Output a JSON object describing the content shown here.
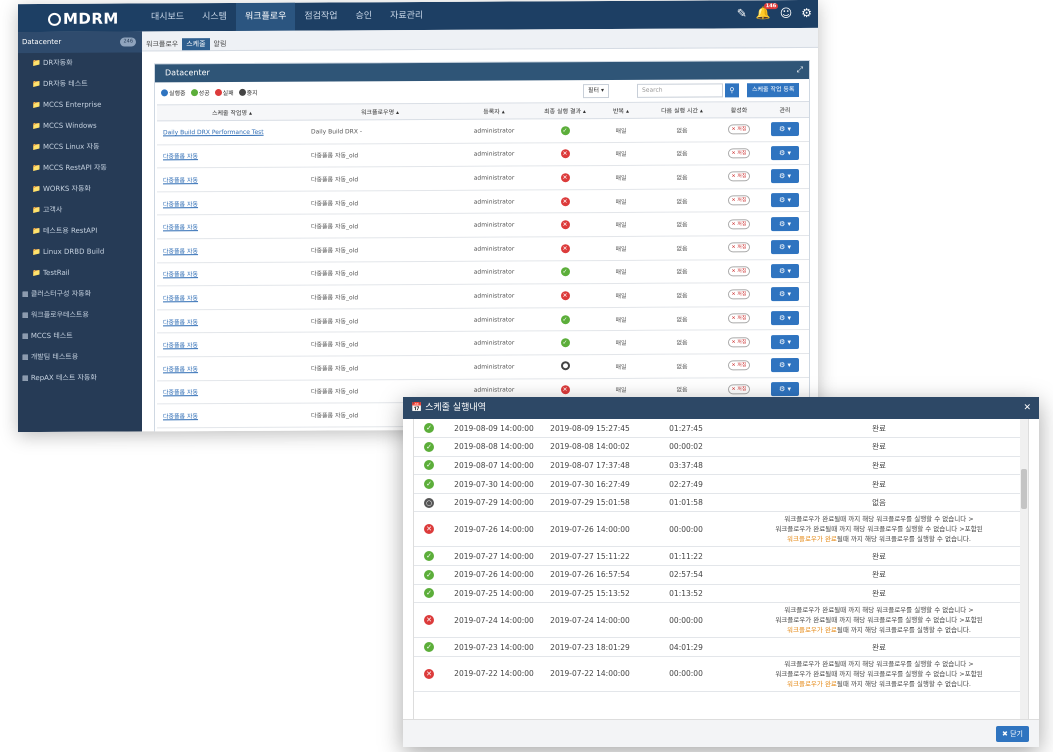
{
  "app": {
    "logo": "MDRM"
  },
  "nav": [
    "대시보드",
    "시스템",
    "워크플로우",
    "점검작업",
    "승인",
    "자료관리"
  ],
  "nav_active_index": 2,
  "top_icons": [
    "edit-icon",
    "bell-icon",
    "user-icon",
    "settings-icon"
  ],
  "notification_count": "146",
  "subtabs": [
    "워크플로우",
    "스케줄",
    "알림"
  ],
  "subtab_active_index": 1,
  "sidebar": {
    "root": {
      "label": "Datacenter",
      "count": "246"
    },
    "children": [
      {
        "label": "DR자동화",
        "count": ""
      },
      {
        "label": "DR자동 테스트",
        "count": ""
      },
      {
        "label": "MCCS Enterprise",
        "count": ""
      },
      {
        "label": "MCCS Windows",
        "count": ""
      },
      {
        "label": "MCCS Linux 자동",
        "count": ""
      },
      {
        "label": "MCCS RestAPI 자동",
        "count": ""
      },
      {
        "label": "WORKS 자동화",
        "count": ""
      },
      {
        "label": "고객사",
        "count": ""
      },
      {
        "label": "테스트용 RestAPI",
        "count": ""
      },
      {
        "label": "Linux DRBD Build",
        "count": ""
      },
      {
        "label": "TestRail",
        "count": ""
      }
    ],
    "groups": [
      {
        "label": "클러스터구성 자동화",
        "count": ""
      },
      {
        "label": "워크플로우테스트용",
        "count": ""
      },
      {
        "label": "MCCS 테스트",
        "count": ""
      },
      {
        "label": "개발팀 테스트용",
        "count": ""
      },
      {
        "label": "RepAX 테스트 자동화",
        "count": ""
      }
    ]
  },
  "panel": {
    "title": "Datacenter",
    "legend": [
      {
        "label": "실행중",
        "color": "#2f74c0"
      },
      {
        "label": "성공",
        "color": "#5cae3a"
      },
      {
        "label": "실패",
        "color": "#dc3b3b"
      },
      {
        "label": "중지",
        "color": "#444444"
      }
    ],
    "filter_label": "필터 ▾",
    "search_placeholder": "Search",
    "register_label": "스케줄 작업 등록",
    "columns": [
      "스케줄 작업명 ▴",
      "워크플로우명 ▴",
      "등록자 ▴",
      "최종 실행 결과 ▴",
      "반복 ▴",
      "다음 실행 시간 ▴",
      "활성화",
      "관리"
    ],
    "rows": [
      {
        "name": "Daily Build DRX Performance Test",
        "workflow": "Daily Build DRX -",
        "owner": "administrator",
        "status": "success",
        "repeat": "매일",
        "next": "없음"
      },
      {
        "name": "다중플롭 자동",
        "workflow": "다중플롭 자동_old",
        "owner": "administrator",
        "status": "fail",
        "repeat": "매일",
        "next": "없음"
      },
      {
        "name": "다중플롭 자동",
        "workflow": "다중플롭 자동_old",
        "owner": "administrator",
        "status": "fail",
        "repeat": "매일",
        "next": "없음"
      },
      {
        "name": "다중플롭 자동",
        "workflow": "다중플롭 자동_old",
        "owner": "administrator",
        "status": "fail",
        "repeat": "매일",
        "next": "없음"
      },
      {
        "name": "다중플롭 자동",
        "workflow": "다중플롭 자동_old",
        "owner": "administrator",
        "status": "fail",
        "repeat": "매일",
        "next": "없음"
      },
      {
        "name": "다중플롭 자동",
        "workflow": "다중플롭 자동_old",
        "owner": "administrator",
        "status": "fail",
        "repeat": "매일",
        "next": "없음"
      },
      {
        "name": "다중플롭 자동",
        "workflow": "다중플롭 자동_old",
        "owner": "administrator",
        "status": "success",
        "repeat": "매일",
        "next": "없음"
      },
      {
        "name": "다중플롭 자동",
        "workflow": "다중플롭 자동_old",
        "owner": "administrator",
        "status": "fail",
        "repeat": "매일",
        "next": "없음"
      },
      {
        "name": "다중플롭 자동",
        "workflow": "다중플롭 자동_old",
        "owner": "administrator",
        "status": "success",
        "repeat": "매일",
        "next": "없음"
      },
      {
        "name": "다중플롭 자동",
        "workflow": "다중플롭 자동_old",
        "owner": "administrator",
        "status": "success",
        "repeat": "매일",
        "next": "없음"
      },
      {
        "name": "다중플롭 자동",
        "workflow": "다중플롭 자동_old",
        "owner": "administrator",
        "status": "stop",
        "repeat": "매일",
        "next": "없음"
      },
      {
        "name": "다중플롭 자동",
        "workflow": "다중플롭 자동_old",
        "owner": "administrator",
        "status": "fail",
        "repeat": "매일",
        "next": "없음"
      },
      {
        "name": "다중플롭 자동",
        "workflow": "다중플롭 자동_old",
        "owner": "administrator",
        "status": "fail",
        "repeat": "매일",
        "next": "없음"
      }
    ],
    "toggle_label": "꺼짐"
  },
  "modal": {
    "title": "스케줄 실행내역",
    "close_label": "닫기",
    "rows": [
      {
        "status": "success",
        "start": "2019-08-09 14:00:00",
        "end": "2019-08-09 15:27:45",
        "duration": "01:27:45",
        "result": [
          "완료"
        ]
      },
      {
        "status": "success",
        "start": "2019-08-08 14:00:00",
        "end": "2019-08-08 14:00:02",
        "duration": "00:00:02",
        "result": [
          "완료"
        ]
      },
      {
        "status": "success",
        "start": "2019-08-07 14:00:00",
        "end": "2019-08-07 17:37:48",
        "duration": "03:37:48",
        "result": [
          "완료"
        ]
      },
      {
        "status": "success",
        "start": "2019-07-30 14:00:00",
        "end": "2019-07-30 16:27:49",
        "duration": "02:27:49",
        "result": [
          "완료"
        ]
      },
      {
        "status": "stop",
        "start": "2019-07-29 14:00:00",
        "end": "2019-07-29 15:01:58",
        "duration": "01:01:58",
        "result": [
          "없음"
        ]
      },
      {
        "status": "fail",
        "start": "2019-07-26 14:00:00",
        "end": "2019-07-26 14:00:00",
        "duration": "00:00:00",
        "result": [
          "워크플로우가 완료될때 까지 해당 워크플로우를 실행할 수 없습니다 >",
          "워크플로우가 완료될때 까지 해당 워크플로우를 실행할 수 없습니다 >포함된",
          "워크플로우가 완료될때 까지 해당 워크플로우를 실행할 수 없습니다."
        ]
      },
      {
        "status": "success",
        "start": "2019-07-27 14:00:00",
        "end": "2019-07-27 15:11:22",
        "duration": "01:11:22",
        "result": [
          "완료"
        ]
      },
      {
        "status": "success",
        "start": "2019-07-26 14:00:00",
        "end": "2019-07-26 16:57:54",
        "duration": "02:57:54",
        "result": [
          "완료"
        ]
      },
      {
        "status": "success",
        "start": "2019-07-25 14:00:00",
        "end": "2019-07-25 15:13:52",
        "duration": "01:13:52",
        "result": [
          "완료"
        ]
      },
      {
        "status": "fail",
        "start": "2019-07-24 14:00:00",
        "end": "2019-07-24 14:00:00",
        "duration": "00:00:00",
        "result": [
          "워크플로우가 완료될때 까지 해당 워크플로우를 실행할 수 없습니다 >",
          "워크플로우가 완료될때 까지 해당 워크플로우를 실행할 수 없습니다 >포함된",
          "워크플로우가 완료될때 까지 해당 워크플로우를 실행할 수 없습니다."
        ]
      },
      {
        "status": "success",
        "start": "2019-07-23 14:00:00",
        "end": "2019-07-23 18:01:29",
        "duration": "04:01:29",
        "result": [
          "완료"
        ]
      },
      {
        "status": "fail",
        "start": "2019-07-22 14:00:00",
        "end": "2019-07-22 14:00:00",
        "duration": "00:00:00",
        "result": [
          "워크플로우가 완료될때 까지 해당 워크플로우를 실행할 수 없습니다 >",
          "워크플로우가 완료될때 까지 해당 워크플로우를 실행할 수 없습니다 >포함된",
          "워크플로우가 완료될때 까지 해당 워크플로우를 실행할 수 없습니다."
        ]
      }
    ],
    "highlight_prefix": "워크플로우가 완료"
  }
}
